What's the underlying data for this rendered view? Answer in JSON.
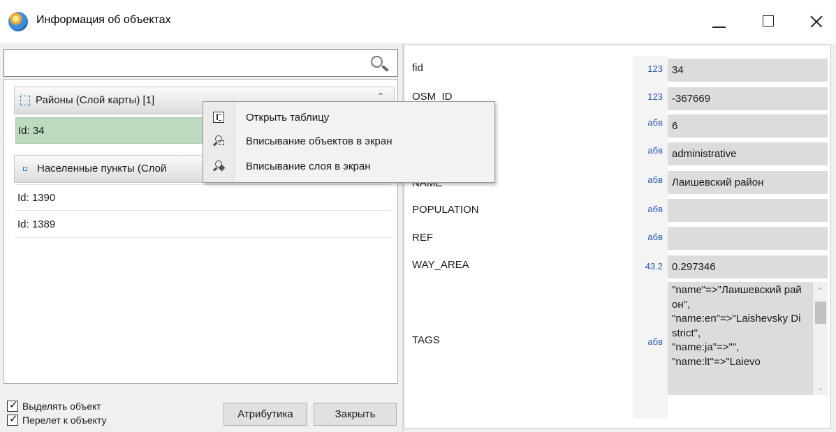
{
  "window": {
    "title": "Информация об объектах"
  },
  "left": {
    "search": {
      "value": "",
      "placeholder": ""
    },
    "groups": [
      {
        "label": "Районы (Слой карты) [1]",
        "items": [
          {
            "label": "Id: 34",
            "selected": true
          }
        ]
      },
      {
        "label": "Населенные пункты (Слой",
        "items": [
          {
            "label": "Id: 1390"
          },
          {
            "label": "Id: 1389"
          }
        ]
      }
    ],
    "options": {
      "highlight_object": {
        "label": "Выделять объект",
        "checked": true
      },
      "fly_to_object": {
        "label": "Перелет к объекту",
        "checked": true
      }
    },
    "buttons": {
      "attributes_label": "Атрибутика",
      "close_label": "Закрыть"
    }
  },
  "context_menu": {
    "items": [
      {
        "label": "Открыть таблицу",
        "icon": "table-icon"
      },
      {
        "label": "Вписывание объектов в экран",
        "icon": "zoom-to-objects-icon"
      },
      {
        "label": "Вписывание слоя в экран",
        "icon": "zoom-to-layer-icon"
      }
    ]
  },
  "attributes": [
    {
      "name": "fid",
      "type": "123",
      "value": "34"
    },
    {
      "name": "OSM_ID",
      "type": "123",
      "value": "-367669"
    },
    {
      "name": "",
      "type": "абв",
      "value": "6"
    },
    {
      "name": "",
      "type": "абв",
      "value": "administrative"
    },
    {
      "name": "NAME",
      "type": "абв",
      "value": "Лаишевский район"
    },
    {
      "name": "POPULATION",
      "type": "абв",
      "value": ""
    },
    {
      "name": "REF",
      "type": "абв",
      "value": ""
    },
    {
      "name": "WAY_AREA",
      "type": "43.2",
      "value": "0.297346"
    },
    {
      "name": "TAGS",
      "type": "абв",
      "value": "\"name\"=>\"Лаишевский район\",\n\"name:en\"=>\"Laishevsky District\",\n\"name:ja\"=>\"\",\n\"name:lt\"=>\"Laievo"
    }
  ]
}
